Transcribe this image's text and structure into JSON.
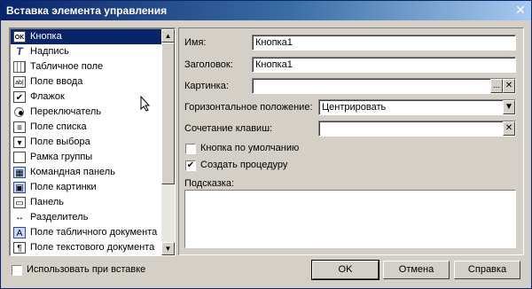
{
  "window": {
    "title": "Вставка элемента управления",
    "close_glyph": "✕"
  },
  "controls_list": {
    "items": [
      {
        "label": "Кнопка",
        "icon": "button-icon",
        "glyph": "OK",
        "selected": true
      },
      {
        "label": "Надпись",
        "icon": "label-icon",
        "glyph": "T"
      },
      {
        "label": "Табличное поле",
        "icon": "table-field-icon",
        "glyph": ""
      },
      {
        "label": "Поле ввода",
        "icon": "input-field-icon",
        "glyph": "ab|"
      },
      {
        "label": "Флажок",
        "icon": "checkbox-icon",
        "glyph": "✔"
      },
      {
        "label": "Переключатель",
        "icon": "radio-icon",
        "glyph": ""
      },
      {
        "label": "Поле списка",
        "icon": "list-field-icon",
        "glyph": "≡"
      },
      {
        "label": "Поле выбора",
        "icon": "combo-field-icon",
        "glyph": "▾"
      },
      {
        "label": "Рамка группы",
        "icon": "group-frame-icon",
        "glyph": ""
      },
      {
        "label": "Командная панель",
        "icon": "command-panel-icon",
        "glyph": "▦"
      },
      {
        "label": "Поле картинки",
        "icon": "picture-field-icon",
        "glyph": "▣"
      },
      {
        "label": "Панель",
        "icon": "panel-icon",
        "glyph": "▭"
      },
      {
        "label": "Разделитель",
        "icon": "splitter-icon",
        "glyph": "↔"
      },
      {
        "label": "Поле табличного документа",
        "icon": "spreadsheet-field-icon",
        "glyph": "A"
      },
      {
        "label": "Поле текстового документа",
        "icon": "text-document-field-icon",
        "glyph": "¶"
      }
    ]
  },
  "form": {
    "name_label": "Имя:",
    "name_value": "Кнопка1",
    "caption_label": "Заголовок:",
    "caption_value": "Кнопка1",
    "picture_label": "Картинка:",
    "picture_value": "",
    "picture_select_glyph": "...",
    "picture_clear_glyph": "✕",
    "halign_label": "Горизонтальное положение:",
    "halign_value": "Центрировать",
    "halign_dropdown_glyph": "▼",
    "shortcut_label": "Сочетание клавиш:",
    "shortcut_value": "",
    "shortcut_clear_glyph": "✕",
    "default_button_label": "Кнопка по умолчанию",
    "default_button_checked": false,
    "create_procedure_label": "Создать процедуру",
    "create_procedure_checked": true,
    "hint_label": "Подсказка:",
    "hint_value": ""
  },
  "footer": {
    "use_on_insert_label": "Использовать при вставке",
    "use_on_insert_checked": false,
    "ok_label": "OK",
    "cancel_label": "Отмена",
    "help_label": "Справка"
  },
  "colors": {
    "titlebar_start": "#0a246a",
    "titlebar_end": "#a6caf0",
    "selection": "#0a246a",
    "face": "#d4d0c8"
  }
}
